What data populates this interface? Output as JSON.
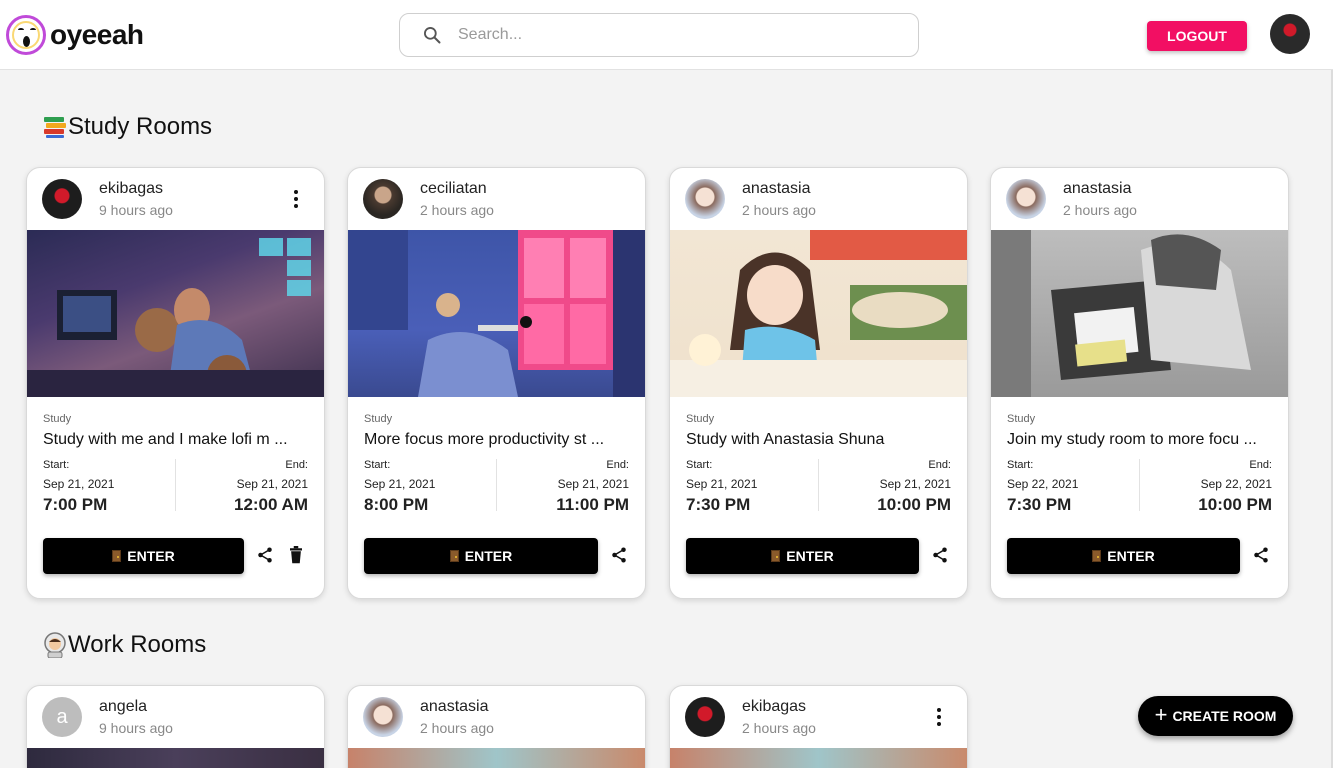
{
  "app": {
    "name": "oyeeah"
  },
  "header": {
    "search_placeholder": "Search...",
    "logout_label": "LOGOUT"
  },
  "sections": {
    "study": {
      "title": "Study Rooms",
      "icon": "books-emoji"
    },
    "work": {
      "title": "Work Rooms",
      "icon": "astronaut-emoji"
    }
  },
  "study_rooms": [
    {
      "user": "ekibagas",
      "time_ago": "9 hours ago",
      "category": "Study",
      "title": "Study with me and I make lofi m ...",
      "start_label": "Start:",
      "start_date": "Sep 21, 2021",
      "start_time": "7:00 PM",
      "end_label": "End:",
      "end_date": "Sep 21, 2021",
      "end_time": "12:00 AM",
      "enter_label": "ENTER",
      "owner": true
    },
    {
      "user": "ceciliatan",
      "time_ago": "2 hours ago",
      "category": "Study",
      "title": "More focus more productivity st ...",
      "start_label": "Start:",
      "start_date": "Sep 21, 2021",
      "start_time": "8:00 PM",
      "end_label": "End:",
      "end_date": "Sep 21, 2021",
      "end_time": "11:00 PM",
      "enter_label": "ENTER",
      "owner": false
    },
    {
      "user": "anastasia",
      "time_ago": "2 hours ago",
      "category": "Study",
      "title": "Study with Anastasia Shuna",
      "start_label": "Start:",
      "start_date": "Sep 21, 2021",
      "start_time": "7:30 PM",
      "end_label": "End:",
      "end_date": "Sep 21, 2021",
      "end_time": "10:00 PM",
      "enter_label": "ENTER",
      "owner": false
    },
    {
      "user": "anastasia",
      "time_ago": "2 hours ago",
      "category": "Study",
      "title": "Join my study room to more focu ...",
      "start_label": "Start:",
      "start_date": "Sep 22, 2021",
      "start_time": "7:30 PM",
      "end_label": "End:",
      "end_date": "Sep 22, 2021",
      "end_time": "10:00 PM",
      "enter_label": "ENTER",
      "owner": false
    }
  ],
  "work_rooms": [
    {
      "user": "angela",
      "time_ago": "9 hours ago",
      "avatar_letter": "a",
      "owner": false
    },
    {
      "user": "anastasia",
      "time_ago": "2 hours ago",
      "owner": false
    },
    {
      "user": "ekibagas",
      "time_ago": "2 hours ago",
      "owner": true
    }
  ],
  "fab": {
    "label": "CREATE ROOM"
  },
  "colors": {
    "accent": "#f20f63",
    "primary_button": "#000000",
    "background": "#f3f3f3"
  }
}
